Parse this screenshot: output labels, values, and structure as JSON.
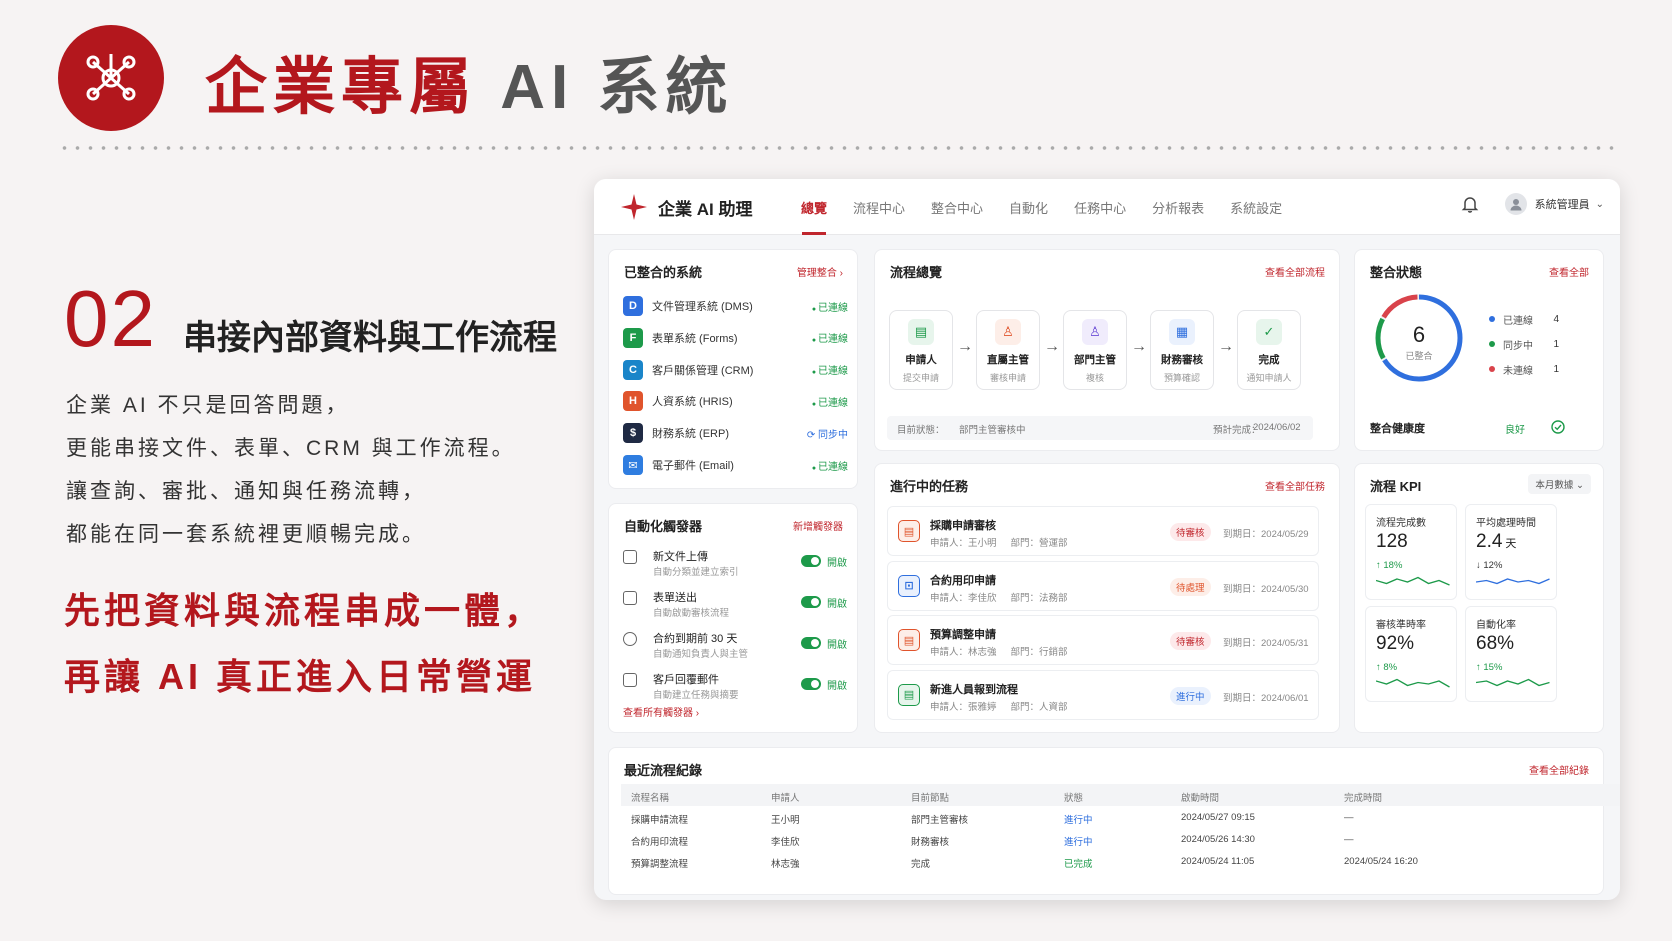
{
  "slide": {
    "title_main": "企業專屬",
    "title_ai": "AI 系統",
    "section_number": "02",
    "section_title": "串接內部資料與工作流程",
    "description": [
      "企業 AI 不只是回答問題，",
      "更能串接文件、表單、CRM 與工作流程。",
      "讓查詢、審批、通知與任務流轉，",
      "都能在同一套系統裡更順暢完成。"
    ],
    "highlight": [
      "先把資料與流程串成一體，",
      "再讓 AI 真正進入日常營運"
    ]
  },
  "app": {
    "brand": "企業 AI 助理",
    "nav_tabs": [
      "總覽",
      "流程中心",
      "整合中心",
      "自動化",
      "任務中心",
      "分析報表",
      "系統設定"
    ],
    "active_tab": "總覽",
    "user": "系統管理員",
    "systems": {
      "title": "已整合的系統",
      "link": "管理整合",
      "items": [
        {
          "name": "文件管理系統 (DMS)",
          "status": "已連線",
          "color": "#2f6fde",
          "glyph": "D"
        },
        {
          "name": "表單系統 (Forms)",
          "status": "已連線",
          "color": "#1d9a4a",
          "glyph": "F"
        },
        {
          "name": "客戶關係管理 (CRM)",
          "status": "已連線",
          "color": "#1a85c9",
          "glyph": "C"
        },
        {
          "name": "人資系統 (HRIS)",
          "status": "已連線",
          "color": "#e0542c",
          "glyph": "H"
        },
        {
          "name": "財務系統 (ERP)",
          "status": "同步中",
          "color": "#1f2a44",
          "glyph": "$"
        },
        {
          "name": "電子郵件 (Email)",
          "status": "已連線",
          "color": "#2f7de0",
          "glyph": "✉"
        }
      ]
    },
    "triggers": {
      "title": "自動化觸發器",
      "link": "新增觸發器",
      "footer": "查看所有觸發器",
      "items": [
        {
          "name": "新文件上傳",
          "desc": "自動分類並建立索引",
          "state": "開啟",
          "icon": "upload-doc-icon"
        },
        {
          "name": "表單送出",
          "desc": "自動啟動審核流程",
          "state": "開啟",
          "icon": "form-icon"
        },
        {
          "name": "合約到期前 30 天",
          "desc": "自動通知負責人與主管",
          "state": "開啟",
          "icon": "clock-icon"
        },
        {
          "name": "客戶回覆郵件",
          "desc": "自動建立任務與摘要",
          "state": "開啟",
          "icon": "mail-icon"
        }
      ]
    },
    "flow": {
      "title": "流程總覽",
      "link": "查看全部流程",
      "steps": [
        {
          "name": "申請人",
          "sub": "提交申請",
          "color": "#1d9a4a",
          "bg": "#e7f5ec",
          "glyph": "▤"
        },
        {
          "name": "直屬主管",
          "sub": "審核申請",
          "color": "#e0542c",
          "bg": "#fdeee8",
          "glyph": "♙"
        },
        {
          "name": "部門主管",
          "sub": "複核",
          "color": "#6a4cd6",
          "bg": "#f0ecfc",
          "glyph": "♙"
        },
        {
          "name": "財務審核",
          "sub": "預算確認",
          "color": "#2f6fde",
          "bg": "#eaf1fd",
          "glyph": "▦"
        },
        {
          "name": "完成",
          "sub": "通知申請人",
          "color": "#1d9a4a",
          "bg": "#e7f5ec",
          "glyph": "✓"
        }
      ],
      "current_label": "目前狀態：",
      "current_value": "部門主管審核中",
      "eta_label": "預計完成：",
      "eta_value": "2024/06/02"
    },
    "tasks": {
      "title": "進行中的任務",
      "link": "查看全部任務",
      "items": [
        {
          "name": "採購申請審核",
          "applicant": "申請人：王小明",
          "dept": "部門：營運部",
          "badge": "待審核",
          "badge_color": "#c0262d",
          "badge_bg": "#fde9ea",
          "due": "到期日：2024/05/29",
          "icon_color": "#e0542c",
          "icon_bg": "#fdeee8",
          "glyph": "▤"
        },
        {
          "name": "合約用印申請",
          "applicant": "申請人：李佳欣",
          "dept": "部門：法務部",
          "badge": "待處理",
          "badge_color": "#e0542c",
          "badge_bg": "#fdeee8",
          "due": "到期日：2024/05/30",
          "icon_color": "#2f6fde",
          "icon_bg": "#eaf1fd",
          "glyph": "⊡"
        },
        {
          "name": "預算調整申請",
          "applicant": "申請人：林志強",
          "dept": "部門：行銷部",
          "badge": "待審核",
          "badge_color": "#c0262d",
          "badge_bg": "#fde9ea",
          "due": "到期日：2024/05/31",
          "icon_color": "#e0542c",
          "icon_bg": "#fdeee8",
          "glyph": "▤"
        },
        {
          "name": "新進人員報到流程",
          "applicant": "申請人：張雅婷",
          "dept": "部門：人資部",
          "badge": "進行中",
          "badge_color": "#2f6fde",
          "badge_bg": "#eaf1fd",
          "due": "到期日：2024/06/01",
          "icon_color": "#1d9a4a",
          "icon_bg": "#e7f5ec",
          "glyph": "▤"
        }
      ]
    },
    "integration": {
      "title": "整合狀態",
      "link": "查看全部",
      "total": "6",
      "total_label": "已整合",
      "legend": [
        {
          "name": "已連線",
          "value": 4,
          "color": "#2f6fde"
        },
        {
          "name": "同步中",
          "value": 1,
          "color": "#1d9a4a"
        },
        {
          "name": "未連線",
          "value": 1,
          "color": "#d9434b"
        }
      ],
      "health_label": "整合健康度",
      "health_value": "良好"
    },
    "kpi": {
      "title": "流程 KPI",
      "period": "本月數據",
      "items": [
        {
          "label": "流程完成數",
          "value": "128",
          "unit": "",
          "delta": "↑ 18%",
          "delta_color": "#1d9a4a",
          "spark_color": "#1d9a4a"
        },
        {
          "label": "平均處理時間",
          "value": "2.4",
          "unit": "天",
          "delta": "↓ 12%",
          "delta_color": "#333",
          "spark_color": "#2f6fde"
        },
        {
          "label": "審核準時率",
          "value": "92%",
          "unit": "",
          "delta": "↑ 8%",
          "delta_color": "#1d9a4a",
          "spark_color": "#1d9a4a"
        },
        {
          "label": "自動化率",
          "value": "68%",
          "unit": "",
          "delta": "↑ 15%",
          "delta_color": "#1d9a4a",
          "spark_color": "#1d9a4a"
        }
      ]
    },
    "records": {
      "title": "最近流程紀錄",
      "link": "查看全部紀錄",
      "columns": [
        "流程名稱",
        "申請人",
        "目前節點",
        "狀態",
        "啟動時間",
        "完成時間"
      ],
      "rows": [
        [
          "採購申請流程",
          "王小明",
          "部門主管審核",
          "進行中",
          "2024/05/27  09:15",
          "—"
        ],
        [
          "合約用印流程",
          "李佳欣",
          "財務審核",
          "進行中",
          "2024/05/26  14:30",
          "—"
        ],
        [
          "預算調整流程",
          "林志強",
          "完成",
          "已完成",
          "2024/05/24  11:05",
          "2024/05/24  16:20"
        ]
      ],
      "status_colors": {
        "進行中": "#2f6fde",
        "已完成": "#1d9a4a"
      }
    }
  }
}
